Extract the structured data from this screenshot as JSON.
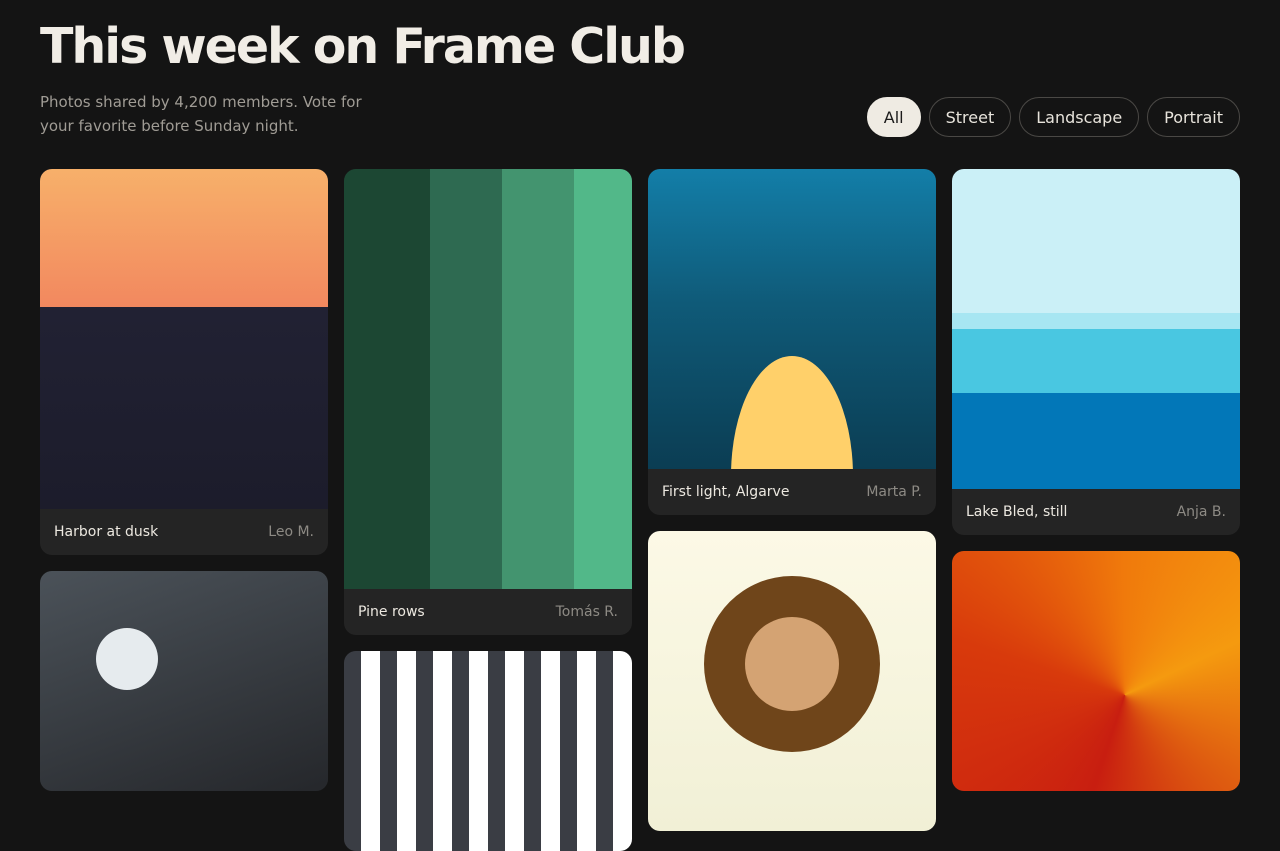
{
  "header": {
    "title": "This week on Frame Club",
    "subtitle": "Photos shared by 4,200 members. Vote for your favorite before Sunday night."
  },
  "filters": [
    {
      "label": "All",
      "active": true
    },
    {
      "label": "Street",
      "active": false
    },
    {
      "label": "Landscape",
      "active": false
    },
    {
      "label": "Portrait",
      "active": false
    }
  ],
  "photos": [
    {
      "title": "Harbor at dusk",
      "author": "Leo M."
    },
    {
      "title": "Pine rows",
      "author": "Tomás R."
    },
    {
      "title": "First light, Algarve",
      "author": "Marta P."
    },
    {
      "title": "Lake Bled, still",
      "author": "Anja B."
    }
  ],
  "colors": {
    "background": "#141414",
    "card": "#242424",
    "chip_active": "#efebe3",
    "pine_stripes": [
      "#1c4733",
      "#2e6a51",
      "#43946f",
      "#52b889"
    ]
  }
}
